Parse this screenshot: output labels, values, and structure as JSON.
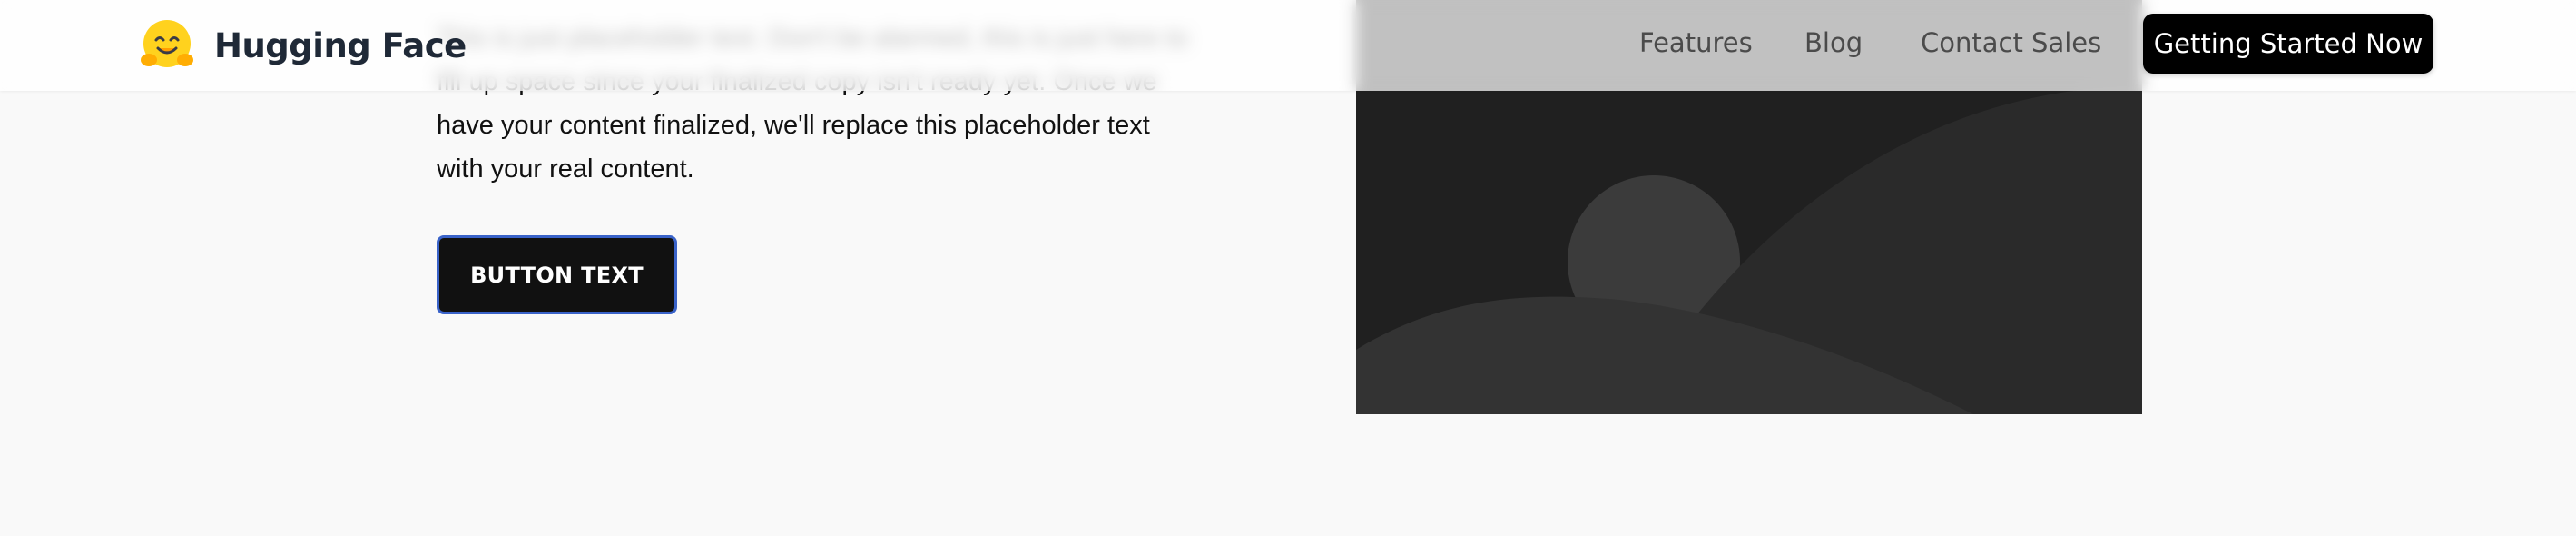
{
  "header": {
    "brand": "Hugging Face",
    "nav": {
      "features": "Features",
      "blog": "Blog",
      "contact_sales": "Contact Sales"
    },
    "cta_label": "Getting Started Now"
  },
  "hero": {
    "paragraph": "This is just placeholder text. Don't be alarmed, this is just here to fill up space since your finalized copy isn't ready yet. Once we have your content finalized, we'll replace this placeholder text with your real content.",
    "button_label": "BUTTON TEXT"
  },
  "icons": {
    "logo": "hugging-face-emoji-icon",
    "image": "image-placeholder-illustration"
  },
  "colors": {
    "background": "#f9f9f9",
    "button": "#111111",
    "button_border": "#3a63c9",
    "image_bg": "#202020"
  }
}
